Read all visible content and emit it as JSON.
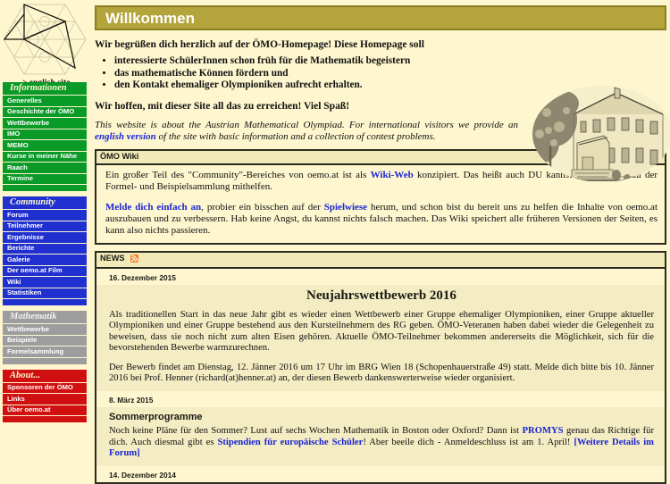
{
  "sidebar": {
    "logo_alt": "oemo-logo",
    "english_link": "-> english site",
    "blocks": [
      {
        "title": "Informationen",
        "color": "#0a9a28",
        "items": [
          "Generelles",
          "Geschichte der ÖMO",
          "Wettbewerbe",
          "IMO",
          "MEMO",
          "Kurse in meiner Nähe",
          "Raach",
          "Termine"
        ]
      },
      {
        "title": "Community",
        "color": "#1f2fd0",
        "items": [
          "Forum",
          "Teilnehmer",
          "Ergebnisse",
          "Berichte",
          "Galerie",
          "Der oemo.at Film",
          "Wiki",
          "Statistiken"
        ]
      },
      {
        "title": "Mathematik",
        "color": "#9d9d9d",
        "items": [
          "Wettbewerbe",
          "Beispiele",
          "Formelsammlung"
        ]
      },
      {
        "title": "About...",
        "color": "#d01010",
        "items": [
          "Sponsoren der ÖMO",
          "Links",
          "Über oemo.at"
        ]
      }
    ]
  },
  "header": {
    "title": "Willkommen",
    "title_bg": "#b3a43c",
    "title_border": "#8c7f23"
  },
  "intro": {
    "lead": "Wir begrüßen dich herzlich auf der ÖMO-Homepage! Diese Homepage soll",
    "bullets": [
      "interessierte SchülerInnen schon früh für die Mathematik begeistern",
      "das mathematische Können fördern und",
      "den Kontakt ehemaliger Olympioniken aufrecht erhalten."
    ],
    "hope": "Wir hoffen, mit dieser Site all das zu erreichen! Viel Spaß!",
    "english_p1": "This website is about the Austrian Mathematical Olympiad. For international visitors we provide an ",
    "english_link": "english version",
    "english_p2": " of the site with basic information and a collection of contest problems.",
    "house_image_alt": "raach-house-sketch"
  },
  "wiki": {
    "head": "ÖMO Wiki",
    "p1_a": "Ein großer Teil des \"Community\"-Bereiches von oemo.at ist als ",
    "p1_link": "Wiki-Web",
    "p1_b": " konzipiert. Das heißt auch DU kannst bei dem Aufbau der Formel- und Beispielsammlung mithelfen.",
    "p2_link1": "Melde dich einfach an",
    "p2_a": ", probier ein bisschen auf der ",
    "p2_link2": "Spielwiese",
    "p2_b": " herum, und schon bist du bereit uns zu helfen die Inhalte von oemo.at auszubauen und zu verbessern. Hab keine Angst, du kannst nichts falsch machen. Das Wiki speichert alle früheren Versionen der Seiten, es kann also nichts passieren."
  },
  "news": {
    "head": "NEWS",
    "rss_icon": "rss-icon",
    "rss_color": "#f08020",
    "items": [
      {
        "date": "16. Dezember 2015",
        "title": "Neujahrswettbewerb 2016",
        "title_align": "center",
        "paragraphs": [
          "Als traditionellen Start in das neue Jahr gibt es wieder einen Wettbewerb einer Gruppe ehemaliger Olympioniken, einer Gruppe aktueller Olympioniken und einer Gruppe bestehend aus den Kursteilnehmern des RG geben. ÖMO-Veteranen haben dabei wieder die Gelegenheit zu beweisen, dass sie noch nicht zum alten Eisen gehören. Aktuelle ÖMO-Teilnehmer bekommen andererseits die Möglichkeit, sich für die bevorstehenden Bewerbe warmzurechnen.",
          "Der Bewerb findet am Dienstag, 12. Jänner 2016 um 17 Uhr im BRG Wien 18 (Schopenhauerstraße 49) statt. Melde dich bitte bis 10. Jänner 2016 bei Prof. Henner (richard(at)henner.at) an, der diesen Bewerb dankenswerterweise wieder organisiert."
        ]
      },
      {
        "date": "8. März 2015",
        "title": "Sommerprogramme",
        "title_align": "left",
        "body_a": "Noch keine Pläne für den Sommer? Lust auf sechs Wochen Mathematik in Boston oder Oxford? Dann ist ",
        "link1": "PROMYS",
        "body_b": " genau das Richtige für dich. Auch diesmal gibt es ",
        "link2": "Stipendien für europäische Schüler",
        "body_c": "! Aber beeile dich - Anmeldeschluss ist am 1. April! ",
        "link3": "[Weitere Details im Forum]"
      },
      {
        "date": "14. Dezember 2014"
      }
    ]
  }
}
